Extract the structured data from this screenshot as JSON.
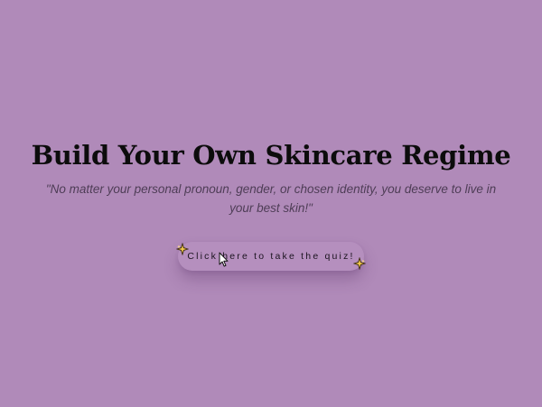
{
  "hero": {
    "title": "Build Your Own Skincare Regime",
    "quote": "\"No matter your personal pronoun, gender, or chosen identity, you deserve to live in your best skin!\""
  },
  "cta": {
    "label": "Click here to take the quiz!"
  },
  "icons": {
    "sparkle": "sparkle-icon",
    "cursor": "mouse-pointer-icon"
  },
  "colors": {
    "background": "#b08ab9",
    "button": "#b58fbe",
    "title": "#0c0c0c",
    "quote": "#4e3d56",
    "sparkle": "#f2c84b"
  }
}
